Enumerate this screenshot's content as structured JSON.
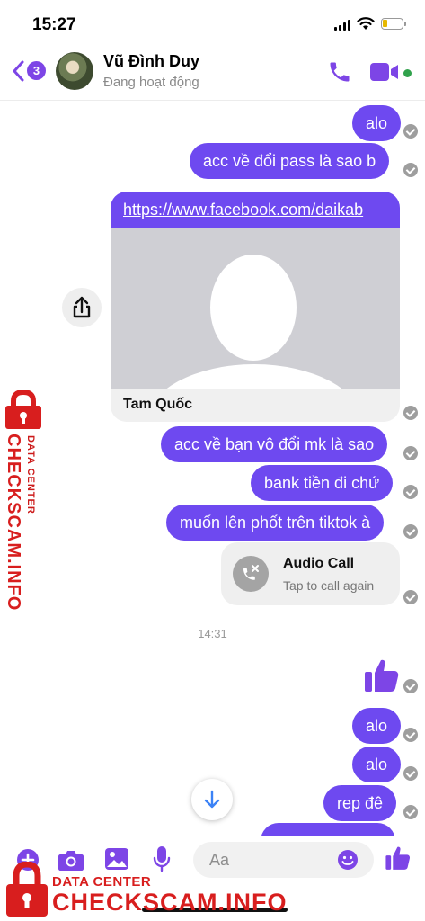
{
  "status_bar": {
    "time": "15:27"
  },
  "header": {
    "back_badge": "3",
    "contact_name": "Vũ Đình Duy",
    "contact_status": "Đang hoạt động"
  },
  "messages": {
    "m1": "alo",
    "m2": "acc về đổi pass là sao b",
    "link_url": "https://www.facebook.com/daikab",
    "link_title": "Tam Quốc",
    "m3": "acc về bạn vô đổi mk là sao",
    "m4": "bank tiền đi chứ",
    "m5": "muốn lên phốt trên tiktok à",
    "call_title": "Audio Call",
    "call_sub": "Tap to call again",
    "timestamp": "14:31",
    "m6": "alo",
    "m7": "alo",
    "m8": "rep đê"
  },
  "composer": {
    "placeholder": "Aa"
  },
  "watermark": {
    "label": "DATA CENTER",
    "brand": "CHECKSCAM.INFO"
  },
  "colors": {
    "accent": "#7d45e6",
    "bubble": "#6e49f0",
    "online": "#31a24c",
    "watermark": "#d81e1e"
  },
  "icons": [
    "back-chevron-icon",
    "phone-icon",
    "video-camera-icon",
    "share-icon",
    "missed-call-icon",
    "thumbs-up-icon",
    "arrow-down-icon",
    "plus-icon",
    "camera-icon",
    "image-icon",
    "microphone-icon",
    "emoji-icon",
    "like-icon",
    "lock-icon"
  ]
}
